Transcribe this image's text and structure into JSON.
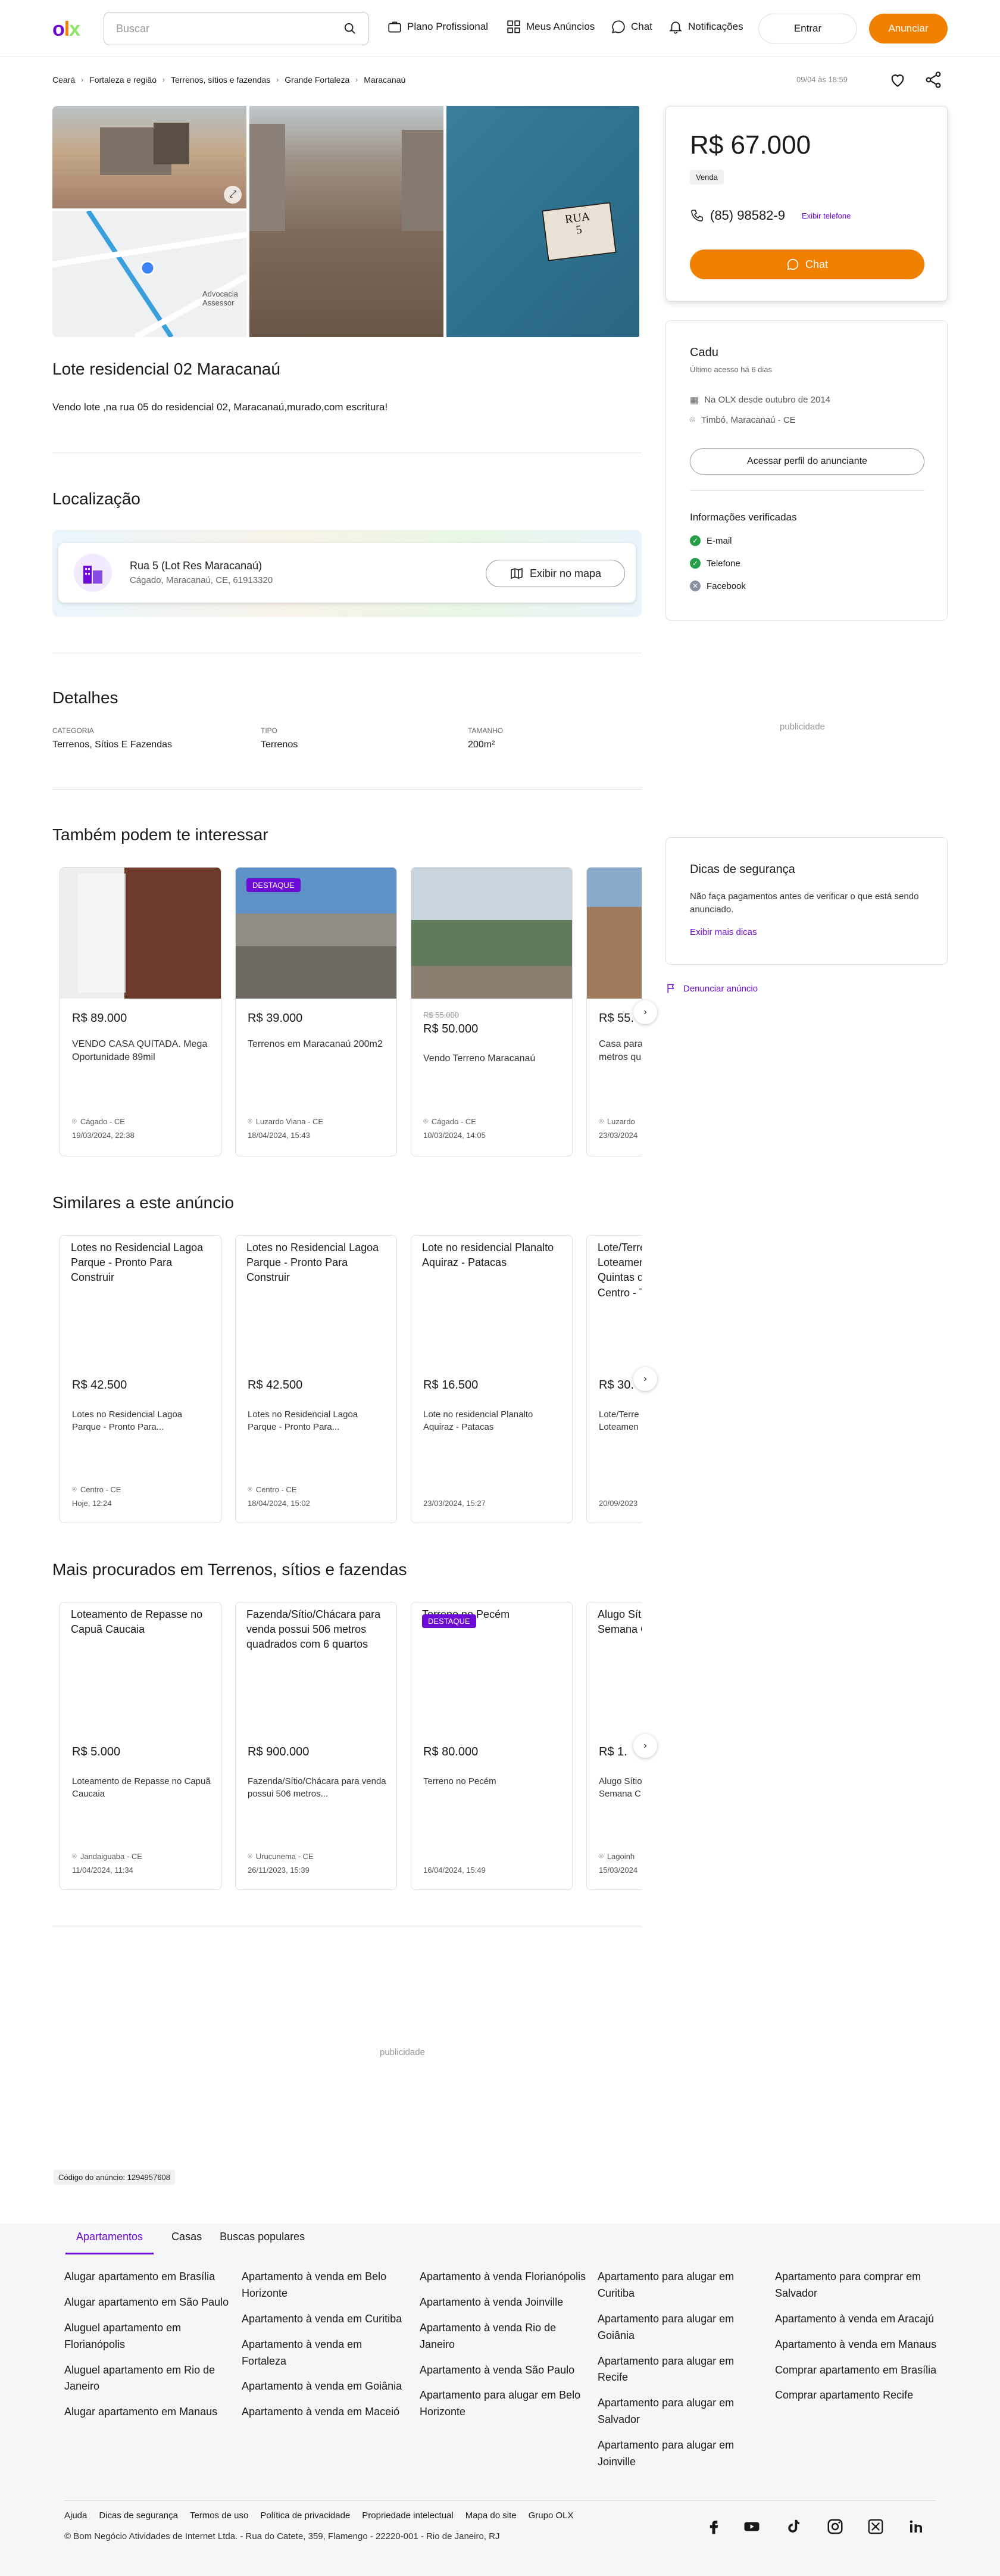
{
  "header": {
    "logo": {
      "o": "o",
      "l": "l",
      "x": "x"
    },
    "search_placeholder": "Buscar",
    "plano": "Plano Profissional",
    "meus": "Meus Anúncios",
    "chat": "Chat",
    "notif": "Notificações",
    "entrar": "Entrar",
    "anunciar": "Anunciar"
  },
  "breadcrumb": [
    "Ceará",
    "Fortaleza e região",
    "Terrenos, sítios e fazendas",
    "Grande Fortaleza",
    "Maracanaú"
  ],
  "date": "09/04 às 18:59",
  "gallery": {
    "map_label": "Advocacia Assessor"
  },
  "ad": {
    "title": "Lote residencial 02 Maracanaú",
    "description": "Vendo lote ,na rua 05 do residencial 02, Maracanaú,murado,com escritura!"
  },
  "location": {
    "heading": "Localização",
    "line1": "Rua 5 (Lot Res Maracanaú)",
    "line2": "Cágado, Maracanaú, CE, 61913320",
    "button": "Exibir no mapa"
  },
  "details": {
    "heading": "Detalhes",
    "items": [
      {
        "k": "CATEGORIA",
        "v": "Terrenos, Sítios E Fazendas"
      },
      {
        "k": "TIPO",
        "v": "Terrenos"
      },
      {
        "k": "TAMANHO",
        "v": "200m²"
      }
    ]
  },
  "interest": {
    "heading": "Também podem te interessar",
    "cards": [
      {
        "price": "R$ 89.000",
        "old": "",
        "title": "VENDO CASA QUITADA. Mega Oportunidade 89mil",
        "loc": "Cágado - CE",
        "date": "19/03/2024, 22:38",
        "badge": ""
      },
      {
        "price": "R$ 39.000",
        "old": "",
        "title": "Terrenos em Maracanaú 200m2",
        "loc": "Luzardo Viana - CE",
        "date": "18/04/2024, 15:43",
        "badge": "DESTAQUE"
      },
      {
        "price": "R$ 50.000",
        "old": "R$ 55.000",
        "title": "Vendo Terreno Maracanaú",
        "loc": "Cágado - CE",
        "date": "10/03/2024, 14:05",
        "badge": ""
      },
      {
        "price": "R$ 55.",
        "old": "",
        "title": "Casa para metros qu",
        "loc": "Luzardo",
        "date": "23/03/2024",
        "badge": ""
      }
    ]
  },
  "similar": {
    "heading": "Similares a este anúncio",
    "cards": [
      {
        "head": "Lotes no Residencial Lagoa Parque - Pronto Para Construir",
        "price": "R$ 42.500",
        "title": "Lotes no Residencial Lagoa Parque - Pronto Para...",
        "loc": "Centro - CE",
        "date": "Hoje, 12:24"
      },
      {
        "head": "Lotes no Residencial Lagoa Parque - Pronto Para Construir",
        "price": "R$ 42.500",
        "title": "Lotes no Residencial Lagoa Parque - Pronto Para...",
        "loc": "Centro - CE",
        "date": "18/04/2024, 15:02"
      },
      {
        "head": "Lote no residencial  Planalto Aquiraz - Patacas",
        "price": "R$ 16.500",
        "title": "Lote no residencial Planalto Aquiraz - Patacas",
        "loc": "",
        "date": "23/03/2024, 15:27"
      },
      {
        "head": "Lote/Terre Loteament Quintas do Centro - T",
        "price": "R$ 30.",
        "title": "Lote/Terre Loteamen",
        "loc": "",
        "date": "20/09/2023"
      }
    ]
  },
  "popular": {
    "heading": "Mais procurados em Terrenos, sítios e fazendas",
    "cards": [
      {
        "head": "Loteamento de Repasse no Capuã Caucaia",
        "price": "R$ 5.000",
        "title": "Loteamento de Repasse no Capuã Caucaia",
        "loc": "Jandaiguaba - CE",
        "date": "11/04/2024, 11:34",
        "badge": ""
      },
      {
        "head": "Fazenda/Sítio/Chácara para venda possui 506 metros quadrados com 6 quartos",
        "price": "R$ 900.000",
        "title": "Fazenda/Sítio/Chácara para venda possui 506 metros...",
        "loc": "Urucunema - CE",
        "date": "26/11/2023, 15:39",
        "badge": ""
      },
      {
        "head": "Terreno no Pecém",
        "price": "R$ 80.000",
        "title": "Terreno no Pecém",
        "loc": "",
        "date": "16/04/2024, 15:49",
        "badge": "DESTAQUE"
      },
      {
        "head": "Alugo Sítio Semana C",
        "price": "R$ 1.",
        "title": "Alugo Sítio Semana C",
        "loc": "Lagoinh",
        "date": "15/03/2024",
        "badge": ""
      }
    ]
  },
  "sidebar": {
    "price": "R$ 67.000",
    "tag": "Venda",
    "phone": "(85) 98582-9",
    "show_phone": "Exibir telefone",
    "chat": "Chat",
    "seller": "Cadu",
    "last_access": "Último acesso há 6 dias",
    "since": "Na OLX desde outubro de 2014",
    "city": "Timbó, Maracanaú - CE",
    "profile": "Acessar perfil do anunciante",
    "verified_title": "Informações verificadas",
    "verified": [
      "E-mail",
      "Telefone",
      "Facebook"
    ],
    "safety_title": "Dicas de segurança",
    "safety_text": "Não faça pagamentos antes de verificar o que está sendo anunciado.",
    "safety_link": "Exibir mais dicas",
    "report": "Denunciar anúncio"
  },
  "ads_label": "publicidade",
  "ad_code": "Código do anúncio: 1294957608",
  "footer": {
    "tabs": [
      "Apartamentos",
      "Casas",
      "Buscas populares"
    ],
    "cols": [
      [
        "Alugar apartamento em Brasília",
        "Alugar apartamento em São Paulo",
        "Aluguel apartamento em Florianópolis",
        "Aluguel apartamento em Rio de Janeiro",
        "Alugar apartamento em Manaus"
      ],
      [
        "Apartamento à venda em Belo Horizonte",
        "Apartamento à venda em Curitiba",
        "Apartamento à venda em Fortaleza",
        "Apartamento à venda em Goiânia",
        "Apartamento à venda em Maceió"
      ],
      [
        "Apartamento à venda Florianópolis",
        "Apartamento à venda Joinville",
        "Apartamento à venda Rio de Janeiro",
        "Apartamento à venda São Paulo",
        "Apartamento para alugar em Belo Horizonte"
      ],
      [
        "Apartamento para alugar em Curitiba",
        "Apartamento para alugar em Goiânia",
        "Apartamento para alugar em Recife",
        "Apartamento para alugar em Salvador",
        "Apartamento para alugar em Joinville"
      ],
      [
        "Apartamento para comprar em Salvador",
        "Apartamento à venda em Aracajú",
        "Apartamento à venda em Manaus",
        "Comprar apartamento em Brasília",
        "Comprar apartamento Recife"
      ]
    ],
    "links": [
      "Ajuda",
      "Dicas de segurança",
      "Termos de uso",
      "Política de privacidade",
      "Propriedade intelectual",
      "Mapa do site",
      "Grupo OLX"
    ],
    "copyright": "© Bom Negócio Atividades de Internet Ltda. - Rua do Catete, 359, Flamengo - 22220-001 - Rio de Janeiro, RJ"
  }
}
